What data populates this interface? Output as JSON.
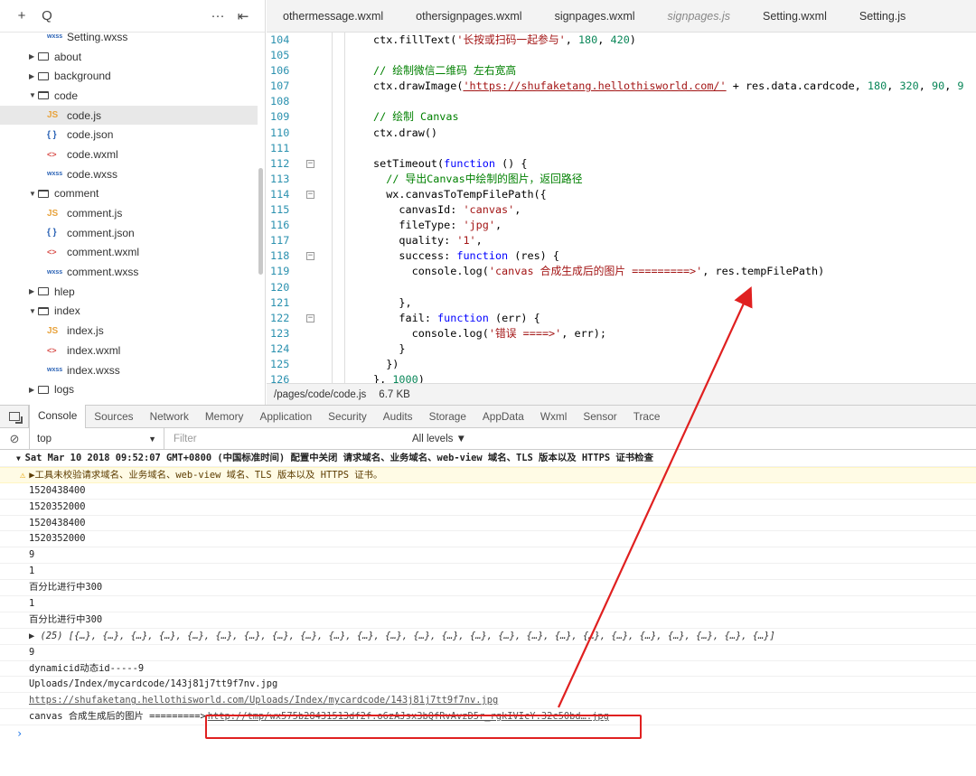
{
  "sidebar": {
    "toolbar": {
      "add": "+",
      "search": "Q",
      "more": "···",
      "collapse": "⇤"
    },
    "tree": [
      {
        "label": "Setting.wxss",
        "type": "wxss",
        "indent": 2
      },
      {
        "label": "about",
        "type": "folder",
        "open": false,
        "indent": 1
      },
      {
        "label": "background",
        "type": "folder",
        "open": false,
        "indent": 1
      },
      {
        "label": "code",
        "type": "folder",
        "open": true,
        "indent": 1
      },
      {
        "label": "code.js",
        "type": "js",
        "indent": 2,
        "selected": true
      },
      {
        "label": "code.json",
        "type": "json",
        "indent": 2
      },
      {
        "label": "code.wxml",
        "type": "wxml",
        "indent": 2
      },
      {
        "label": "code.wxss",
        "type": "wxss",
        "indent": 2
      },
      {
        "label": "comment",
        "type": "folder",
        "open": true,
        "indent": 1
      },
      {
        "label": "comment.js",
        "type": "js",
        "indent": 2
      },
      {
        "label": "comment.json",
        "type": "json",
        "indent": 2
      },
      {
        "label": "comment.wxml",
        "type": "wxml",
        "indent": 2
      },
      {
        "label": "comment.wxss",
        "type": "wxss",
        "indent": 2
      },
      {
        "label": "hlep",
        "type": "folder",
        "open": false,
        "indent": 1
      },
      {
        "label": "index",
        "type": "folder",
        "open": true,
        "indent": 1
      },
      {
        "label": "index.js",
        "type": "js",
        "indent": 2
      },
      {
        "label": "index.wxml",
        "type": "wxml",
        "indent": 2
      },
      {
        "label": "index.wxss",
        "type": "wxss",
        "indent": 2
      },
      {
        "label": "logs",
        "type": "folder",
        "open": false,
        "indent": 1
      }
    ],
    "type_labels": {
      "wxss": "wxss",
      "js": "JS",
      "json": "{ }",
      "wxml": "<>"
    }
  },
  "editor": {
    "tabs": [
      {
        "label": "othermessage.wxml",
        "italic": false
      },
      {
        "label": "othersignpages.wxml",
        "italic": false
      },
      {
        "label": "signpages.wxml",
        "italic": false
      },
      {
        "label": "signpages.js",
        "italic": true
      },
      {
        "label": "Setting.wxml",
        "italic": false
      },
      {
        "label": "Setting.js",
        "italic": false
      }
    ],
    "lines": [
      {
        "n": "104",
        "fold": false,
        "html": "ctx.fillText(<span class=\"s\">'长按或扫码一起参与'</span>, <span class=\"n\">180</span>, <span class=\"n\">420</span>)",
        "indent": 0
      },
      {
        "n": "105",
        "fold": false,
        "html": "",
        "indent": 0
      },
      {
        "n": "106",
        "fold": false,
        "html": "<span class=\"c\">// 绘制微信二维码 左右宽高</span>",
        "indent": 0
      },
      {
        "n": "107",
        "fold": false,
        "html": "ctx.drawImage(<span class=\"u\">'https://shufaketang.hellothisworld.com/'</span> + res.data.cardcode, <span class=\"n\">180</span>, <span class=\"n\">320</span>, <span class=\"n\">90</span>, <span class=\"n\">9</span>",
        "indent": 0
      },
      {
        "n": "108",
        "fold": false,
        "html": "",
        "indent": 0
      },
      {
        "n": "109",
        "fold": false,
        "html": "<span class=\"c\">// 绘制 Canvas</span>",
        "indent": 0
      },
      {
        "n": "110",
        "fold": false,
        "html": "ctx.draw()",
        "indent": 0
      },
      {
        "n": "111",
        "fold": false,
        "html": "",
        "indent": 0
      },
      {
        "n": "112",
        "fold": true,
        "html": "setTimeout(<span class=\"k\">function</span> () {",
        "indent": 0
      },
      {
        "n": "113",
        "fold": false,
        "html": "  <span class=\"c\">// 导出Canvas中绘制的图片，返回路径</span>",
        "indent": 0
      },
      {
        "n": "114",
        "fold": true,
        "html": "  wx.canvasToTempFilePath({",
        "indent": 0
      },
      {
        "n": "115",
        "fold": false,
        "html": "    canvasId: <span class=\"s\">'canvas'</span>,",
        "indent": 0
      },
      {
        "n": "116",
        "fold": false,
        "html": "    fileType: <span class=\"s\">'jpg'</span>,",
        "indent": 0
      },
      {
        "n": "117",
        "fold": false,
        "html": "    quality: <span class=\"s\">'1'</span>,",
        "indent": 0
      },
      {
        "n": "118",
        "fold": true,
        "html": "    success: <span class=\"k\">function</span> (res) {",
        "indent": 0
      },
      {
        "n": "119",
        "fold": false,
        "html": "      console.log(<span class=\"s\">'canvas 合成生成后的图片 =========&gt;'</span>, res.tempFilePath)",
        "indent": 0
      },
      {
        "n": "120",
        "fold": false,
        "html": "",
        "indent": 0
      },
      {
        "n": "121",
        "fold": false,
        "html": "    },",
        "indent": 0
      },
      {
        "n": "122",
        "fold": true,
        "html": "    fail: <span class=\"k\">function</span> (err) {",
        "indent": 0
      },
      {
        "n": "123",
        "fold": false,
        "html": "      console.log(<span class=\"s\">'错误 ====&gt;'</span>, err);",
        "indent": 0
      },
      {
        "n": "124",
        "fold": false,
        "html": "    }",
        "indent": 0
      },
      {
        "n": "125",
        "fold": false,
        "html": "  })",
        "indent": 0
      },
      {
        "n": "126",
        "fold": false,
        "html": "}, <span class=\"n\">1000</span>)",
        "indent": 0
      }
    ],
    "status": {
      "path": "/pages/code/code.js",
      "size": "6.7 KB"
    }
  },
  "devtools": {
    "tabs": [
      "Console",
      "Sources",
      "Network",
      "Memory",
      "Application",
      "Security",
      "Audits",
      "Storage",
      "AppData",
      "Wxml",
      "Sensor",
      "Trace"
    ],
    "active_tab": "Console",
    "context": "top",
    "filter_placeholder": "Filter",
    "levels": "All levels ▼",
    "console": [
      {
        "kind": "header",
        "text": "Sat Mar 10 2018 09:52:07 GMT+0800 (中国标准时间) 配置中关闭 请求域名、业务域名、web-view 域名、TLS 版本以及 HTTPS 证书检查"
      },
      {
        "kind": "warn",
        "text": "▶工具未校验请求域名、业务域名、web-view 域名、TLS 版本以及 HTTPS 证书。"
      },
      {
        "kind": "log",
        "text": "1520438400"
      },
      {
        "kind": "log",
        "text": "1520352000"
      },
      {
        "kind": "log",
        "text": "1520438400"
      },
      {
        "kind": "log",
        "text": "1520352000"
      },
      {
        "kind": "log",
        "text": "9"
      },
      {
        "kind": "log",
        "text": "1"
      },
      {
        "kind": "log",
        "text": "百分比进行中300"
      },
      {
        "kind": "log",
        "text": "1"
      },
      {
        "kind": "log",
        "text": "百分比进行中300"
      },
      {
        "kind": "object",
        "text": "▶ (25) [{…}, {…}, {…}, {…}, {…}, {…}, {…}, {…}, {…}, {…}, {…}, {…}, {…}, {…}, {…}, {…}, {…}, {…}, {…}, {…}, {…}, {…}, {…}, {…}, {…}]"
      },
      {
        "kind": "log",
        "text": "9"
      },
      {
        "kind": "log",
        "text": "dynamicid动态id-----9"
      },
      {
        "kind": "log",
        "text": "Uploads/Index/mycardcode/143j81j7tt9f7nv.jpg"
      },
      {
        "kind": "link",
        "text": "https://shufaketang.hellothisworld.com/Uploads/Index/mycardcode/143j81j7tt9f7nv.jpg"
      },
      {
        "kind": "result",
        "prefix": "canvas 合成生成后的图片 =========>",
        "text": "http://tmp/wx575b28431513df2f.o6zAJsx3bQfRvAvzD5r_rgkIVIcY.32c50bd….jpg"
      }
    ],
    "prompt": "›"
  },
  "annotation": {
    "color": "#e02020"
  }
}
